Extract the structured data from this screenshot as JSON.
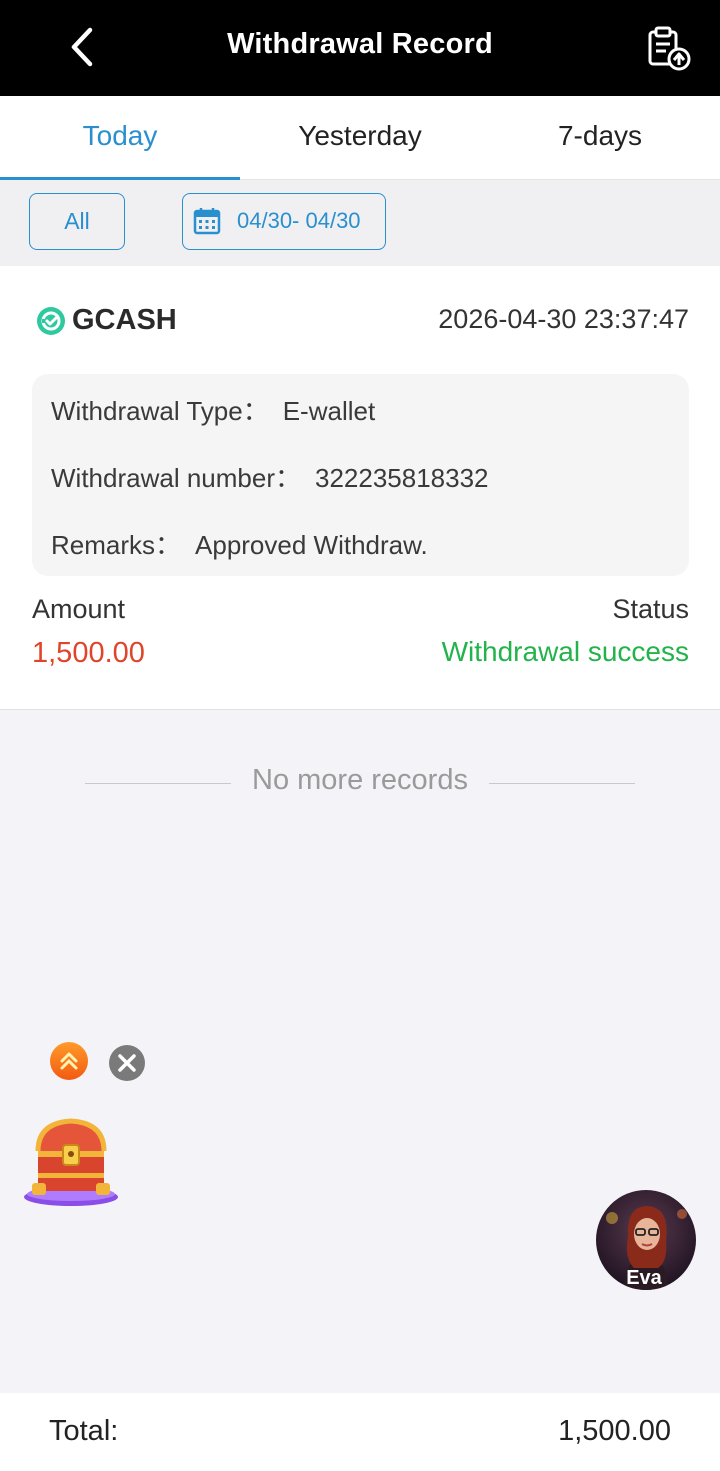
{
  "header": {
    "title": "Withdrawal Record",
    "back_icon": "chevron-left-icon",
    "export_icon": "clipboard-upload-icon"
  },
  "tabs": [
    {
      "label": "Today",
      "active": true
    },
    {
      "label": "Yesterday",
      "active": false
    },
    {
      "label": "7-days",
      "active": false
    }
  ],
  "filters": {
    "all_label": "All",
    "date_range": "04/30- 04/30",
    "date_icon": "calendar-icon"
  },
  "record": {
    "channel": "GCASH",
    "datetime": "2026-04-30 23:37:47",
    "details": [
      {
        "label": "Withdrawal Type：",
        "value": "E-wallet"
      },
      {
        "label": "Withdrawal number：",
        "value": "322235818332"
      },
      {
        "label": "Remarks：",
        "value": "Approved Withdraw."
      }
    ],
    "amount_label": "Amount",
    "amount_value": "1,500.00",
    "status_label": "Status",
    "status_value": "Withdrawal success"
  },
  "list_end_text": "No more records",
  "floating": {
    "avatar_name": "Eva"
  },
  "footer": {
    "total_label": "Total:",
    "total_value": "1,500.00"
  },
  "colors": {
    "accent": "#2a8fcf",
    "amount": "#e0442a",
    "success": "#22b34a",
    "header_bg": "#000000"
  }
}
